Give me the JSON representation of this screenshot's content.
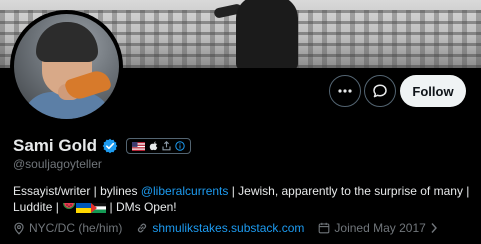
{
  "profile": {
    "name": "Sami Gold",
    "handle": "@souljagoyteller",
    "bio": {
      "prefix": "Essayist/writer | bylines ",
      "mention": "@liberalcurrents",
      "middle": " | Jewish, apparently to the surprise of many | Luddite | ",
      "suffix": " | DMs Open!"
    },
    "location": "NYC/DC (he/him)",
    "website": "shmulikstakes.substack.com",
    "joined": "Joined May 2017"
  },
  "actions": {
    "follow_label": "Follow",
    "more_icon": "more-horizontal-icon",
    "message_icon": "message-bubble-icon"
  },
  "badge_chip": [
    "us-flag-icon",
    "apple-icon",
    "share-icon",
    "info-icon"
  ],
  "colors": {
    "background": "#000000",
    "text": "#e7e9ea",
    "muted": "#71767b",
    "link": "#1d9bf0",
    "verified": "#1d9bf0",
    "follow_button_bg": "#eff3f4",
    "follow_button_text": "#0f1419"
  }
}
